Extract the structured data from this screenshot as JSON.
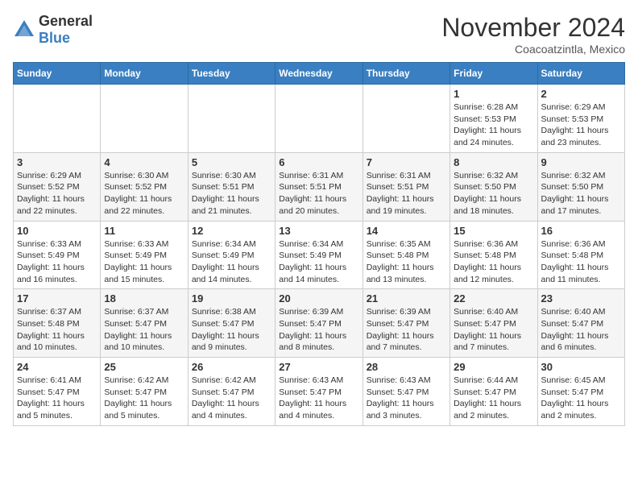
{
  "header": {
    "logo_general": "General",
    "logo_blue": "Blue",
    "month_title": "November 2024",
    "subtitle": "Coacoatzintla, Mexico"
  },
  "days_of_week": [
    "Sunday",
    "Monday",
    "Tuesday",
    "Wednesday",
    "Thursday",
    "Friday",
    "Saturday"
  ],
  "weeks": [
    [
      {
        "day": "",
        "info": ""
      },
      {
        "day": "",
        "info": ""
      },
      {
        "day": "",
        "info": ""
      },
      {
        "day": "",
        "info": ""
      },
      {
        "day": "",
        "info": ""
      },
      {
        "day": "1",
        "info": "Sunrise: 6:28 AM\nSunset: 5:53 PM\nDaylight: 11 hours and 24 minutes."
      },
      {
        "day": "2",
        "info": "Sunrise: 6:29 AM\nSunset: 5:53 PM\nDaylight: 11 hours and 23 minutes."
      }
    ],
    [
      {
        "day": "3",
        "info": "Sunrise: 6:29 AM\nSunset: 5:52 PM\nDaylight: 11 hours and 22 minutes."
      },
      {
        "day": "4",
        "info": "Sunrise: 6:30 AM\nSunset: 5:52 PM\nDaylight: 11 hours and 22 minutes."
      },
      {
        "day": "5",
        "info": "Sunrise: 6:30 AM\nSunset: 5:51 PM\nDaylight: 11 hours and 21 minutes."
      },
      {
        "day": "6",
        "info": "Sunrise: 6:31 AM\nSunset: 5:51 PM\nDaylight: 11 hours and 20 minutes."
      },
      {
        "day": "7",
        "info": "Sunrise: 6:31 AM\nSunset: 5:51 PM\nDaylight: 11 hours and 19 minutes."
      },
      {
        "day": "8",
        "info": "Sunrise: 6:32 AM\nSunset: 5:50 PM\nDaylight: 11 hours and 18 minutes."
      },
      {
        "day": "9",
        "info": "Sunrise: 6:32 AM\nSunset: 5:50 PM\nDaylight: 11 hours and 17 minutes."
      }
    ],
    [
      {
        "day": "10",
        "info": "Sunrise: 6:33 AM\nSunset: 5:49 PM\nDaylight: 11 hours and 16 minutes."
      },
      {
        "day": "11",
        "info": "Sunrise: 6:33 AM\nSunset: 5:49 PM\nDaylight: 11 hours and 15 minutes."
      },
      {
        "day": "12",
        "info": "Sunrise: 6:34 AM\nSunset: 5:49 PM\nDaylight: 11 hours and 14 minutes."
      },
      {
        "day": "13",
        "info": "Sunrise: 6:34 AM\nSunset: 5:49 PM\nDaylight: 11 hours and 14 minutes."
      },
      {
        "day": "14",
        "info": "Sunrise: 6:35 AM\nSunset: 5:48 PM\nDaylight: 11 hours and 13 minutes."
      },
      {
        "day": "15",
        "info": "Sunrise: 6:36 AM\nSunset: 5:48 PM\nDaylight: 11 hours and 12 minutes."
      },
      {
        "day": "16",
        "info": "Sunrise: 6:36 AM\nSunset: 5:48 PM\nDaylight: 11 hours and 11 minutes."
      }
    ],
    [
      {
        "day": "17",
        "info": "Sunrise: 6:37 AM\nSunset: 5:48 PM\nDaylight: 11 hours and 10 minutes."
      },
      {
        "day": "18",
        "info": "Sunrise: 6:37 AM\nSunset: 5:47 PM\nDaylight: 11 hours and 10 minutes."
      },
      {
        "day": "19",
        "info": "Sunrise: 6:38 AM\nSunset: 5:47 PM\nDaylight: 11 hours and 9 minutes."
      },
      {
        "day": "20",
        "info": "Sunrise: 6:39 AM\nSunset: 5:47 PM\nDaylight: 11 hours and 8 minutes."
      },
      {
        "day": "21",
        "info": "Sunrise: 6:39 AM\nSunset: 5:47 PM\nDaylight: 11 hours and 7 minutes."
      },
      {
        "day": "22",
        "info": "Sunrise: 6:40 AM\nSunset: 5:47 PM\nDaylight: 11 hours and 7 minutes."
      },
      {
        "day": "23",
        "info": "Sunrise: 6:40 AM\nSunset: 5:47 PM\nDaylight: 11 hours and 6 minutes."
      }
    ],
    [
      {
        "day": "24",
        "info": "Sunrise: 6:41 AM\nSunset: 5:47 PM\nDaylight: 11 hours and 5 minutes."
      },
      {
        "day": "25",
        "info": "Sunrise: 6:42 AM\nSunset: 5:47 PM\nDaylight: 11 hours and 5 minutes."
      },
      {
        "day": "26",
        "info": "Sunrise: 6:42 AM\nSunset: 5:47 PM\nDaylight: 11 hours and 4 minutes."
      },
      {
        "day": "27",
        "info": "Sunrise: 6:43 AM\nSunset: 5:47 PM\nDaylight: 11 hours and 4 minutes."
      },
      {
        "day": "28",
        "info": "Sunrise: 6:43 AM\nSunset: 5:47 PM\nDaylight: 11 hours and 3 minutes."
      },
      {
        "day": "29",
        "info": "Sunrise: 6:44 AM\nSunset: 5:47 PM\nDaylight: 11 hours and 2 minutes."
      },
      {
        "day": "30",
        "info": "Sunrise: 6:45 AM\nSunset: 5:47 PM\nDaylight: 11 hours and 2 minutes."
      }
    ]
  ]
}
